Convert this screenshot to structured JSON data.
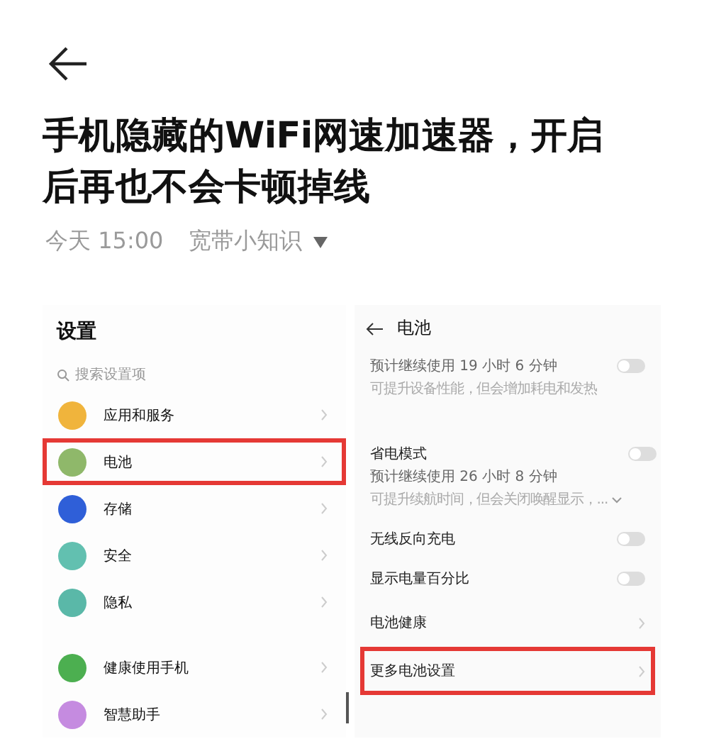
{
  "article": {
    "title": "手机隐藏的WiFi网速加速器，开启后再也不会卡顿掉线",
    "date": "今天 15:00",
    "author": "宽带小知识"
  },
  "settings": {
    "title": "设置",
    "search": {
      "placeholder": "搜索设置项"
    },
    "groups": [
      {
        "items": [
          {
            "label": "应用和服务",
            "color": "#f0b43c",
            "highlighted": false
          },
          {
            "label": "电池",
            "color": "#8fb86a",
            "highlighted": true
          },
          {
            "label": "存储",
            "color": "#2f5fd8",
            "highlighted": false
          },
          {
            "label": "安全",
            "color": "#62c0b0",
            "highlighted": false
          },
          {
            "label": "隐私",
            "color": "#5ab8a8",
            "highlighted": false
          }
        ]
      },
      {
        "items": [
          {
            "label": "健康使用手机",
            "color": "#4caf50",
            "highlighted": false
          },
          {
            "label": "智慧助手",
            "color": "#c58be0",
            "highlighted": false
          }
        ]
      }
    ]
  },
  "battery": {
    "title": "电池",
    "rows": [
      {
        "kind": "toggle",
        "lines": [
          "预计继续使用 19 小时 6 分钟",
          "可提升设备性能，但会增加耗电和发热"
        ],
        "on": false,
        "expandable": false,
        "highlighted": false
      },
      {
        "kind": "toggle",
        "title": "省电模式",
        "lines": [
          "预计继续使用 26 小时 8 分钟",
          "可提升续航时间，但会关闭唤醒显示，..."
        ],
        "on": false,
        "expandable": true,
        "highlighted": false
      },
      {
        "kind": "toggle",
        "title": "无线反向充电",
        "on": false,
        "highlighted": false
      },
      {
        "kind": "toggle",
        "title": "显示电量百分比",
        "on": false,
        "highlighted": false
      },
      {
        "kind": "link",
        "title": "电池健康",
        "highlighted": false
      },
      {
        "kind": "link",
        "title": "更多电池设置",
        "highlighted": true
      }
    ]
  }
}
